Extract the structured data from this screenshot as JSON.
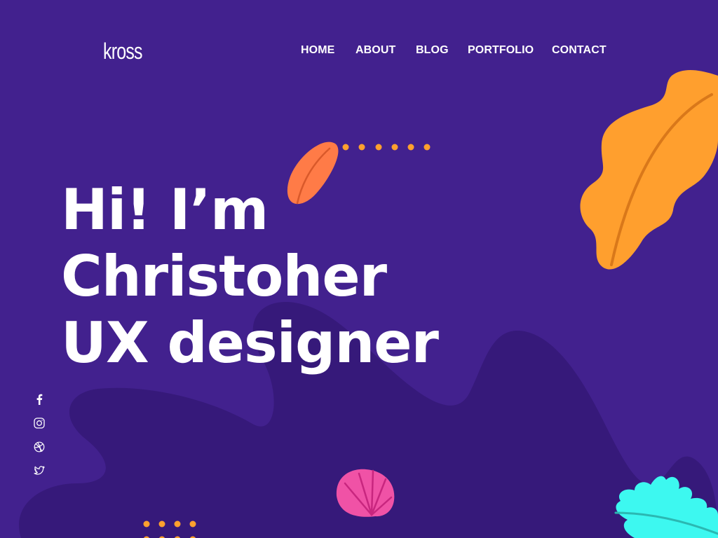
{
  "header": {
    "logo_text": "kross",
    "nav": [
      {
        "label": "HOME"
      },
      {
        "label": "ABOUT"
      },
      {
        "label": "BLOG"
      },
      {
        "label": "PORTFOLIO"
      },
      {
        "label": "CONTACT"
      }
    ]
  },
  "hero": {
    "lines": [
      "Hi! I’m",
      "Christoher",
      "UX designer"
    ]
  },
  "social": [
    {
      "icon": "facebook-icon"
    },
    {
      "icon": "instagram-icon"
    },
    {
      "icon": "dribbble-icon"
    },
    {
      "icon": "twitter-icon"
    }
  ],
  "colors": {
    "background": "#42218E",
    "blob": "#36197A",
    "orange_leaf": "#FF9F2E",
    "coral_leaf": "#FF7B47",
    "dots": "#FFA02E",
    "pink_shell": "#F052A6",
    "cyan_leaf": "#3DF8F0",
    "text": "#FFFFFF"
  }
}
